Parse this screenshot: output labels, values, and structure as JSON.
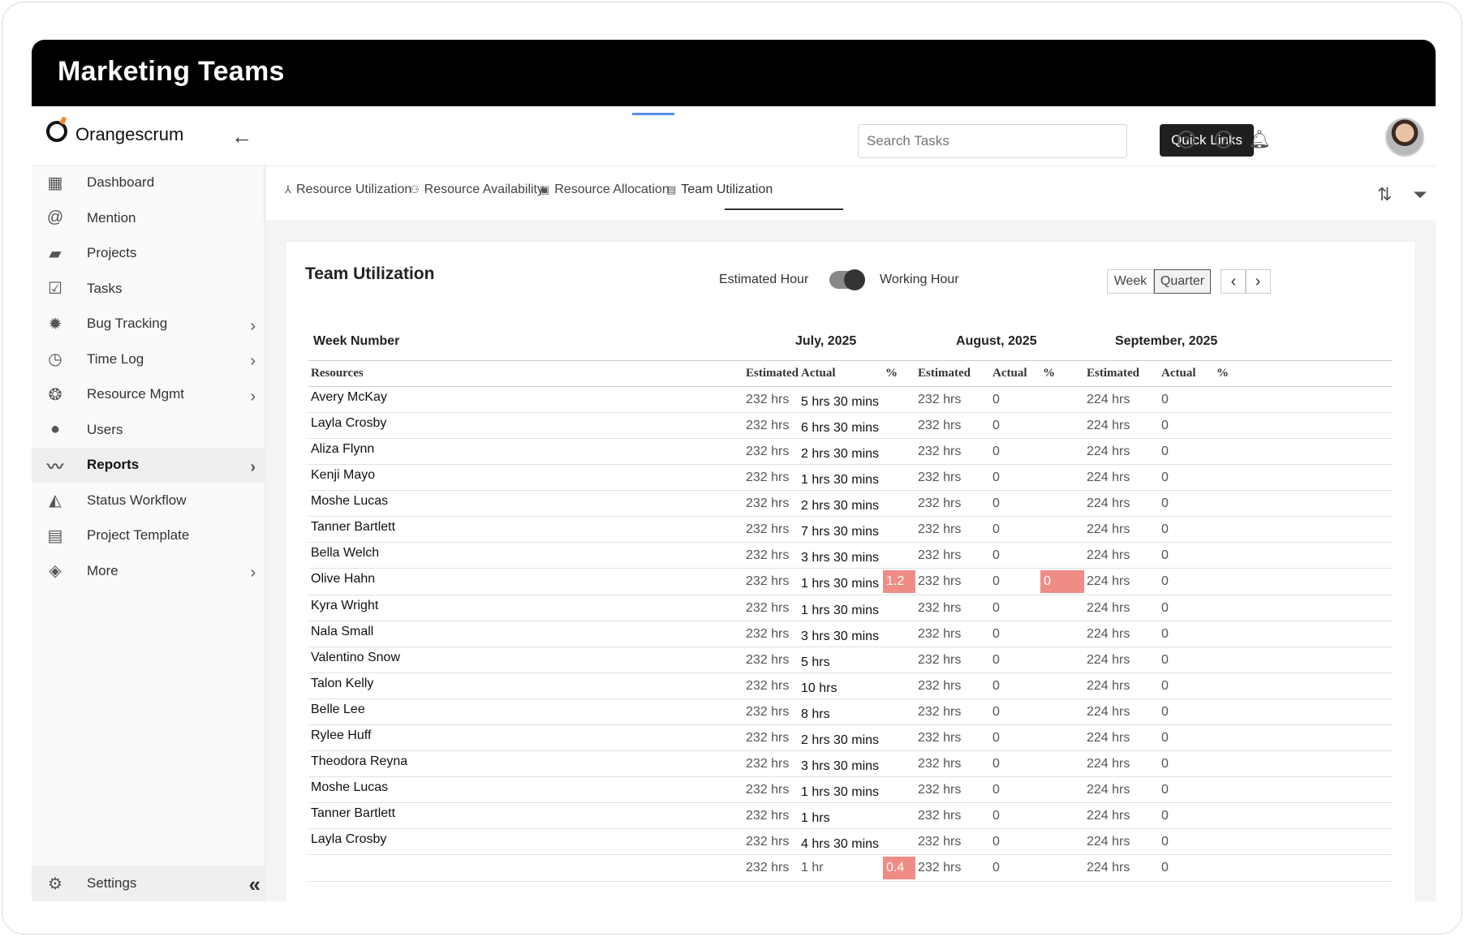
{
  "banner": {
    "title": "Marketing Teams"
  },
  "brand": {
    "name": "Orangescrum",
    "accent": "#f7852a"
  },
  "sidebar": {
    "items": [
      {
        "label": "Dashboard",
        "icon": "dashboard-icon",
        "glyph": "▦",
        "expandable": false,
        "active": false
      },
      {
        "label": "Mention",
        "icon": "at-sign-icon",
        "glyph": "@",
        "expandable": false,
        "active": false
      },
      {
        "label": "Projects",
        "icon": "briefcase-icon",
        "glyph": "▰",
        "expandable": false,
        "active": false
      },
      {
        "label": "Tasks",
        "icon": "task-check-icon",
        "glyph": "☑",
        "expandable": false,
        "active": false
      },
      {
        "label": "Bug Tracking",
        "icon": "bug-icon",
        "glyph": "✹",
        "expandable": true,
        "active": false
      },
      {
        "label": "Time Log",
        "icon": "clock-icon",
        "glyph": "◷",
        "expandable": true,
        "active": false
      },
      {
        "label": "Resource Mgmt",
        "icon": "resource-icon",
        "glyph": "❂",
        "expandable": true,
        "active": false
      },
      {
        "label": "Users",
        "icon": "user-icon",
        "glyph": "●",
        "expandable": false,
        "active": false
      },
      {
        "label": "Reports",
        "icon": "trend-line-icon",
        "glyph": "〰",
        "expandable": true,
        "active": true
      },
      {
        "label": "Status Workflow",
        "icon": "workflow-icon",
        "glyph": "◭",
        "expandable": false,
        "active": false
      },
      {
        "label": "Project Template",
        "icon": "template-icon",
        "glyph": "▤",
        "expandable": false,
        "active": false
      },
      {
        "label": "More",
        "icon": "layers-icon",
        "glyph": "◈",
        "expandable": true,
        "active": false
      }
    ],
    "settings_label": "Settings"
  },
  "header": {
    "search_placeholder": "Search Tasks",
    "quick_links_label": "Quick Links"
  },
  "tabs": [
    {
      "label": "Resource Utilization",
      "icon": "hierarchy-icon",
      "glyph": "⅄"
    },
    {
      "label": "Resource Availability",
      "icon": "users-icon",
      "glyph": "⚇"
    },
    {
      "label": "Resource Allocation",
      "icon": "allocation-icon",
      "glyph": "▣"
    },
    {
      "label": "Team Utilization",
      "icon": "document-icon",
      "glyph": "▤"
    }
  ],
  "card": {
    "title": "Team Utilization",
    "toggle_left": "Estimated Hour",
    "toggle_right": "Working Hour",
    "toggle_on": true,
    "period_week": "Week",
    "period_quarter": "Quarter",
    "selected_period": "Quarter"
  },
  "table": {
    "week_number_label": "Week Number",
    "months": [
      "July, 2025",
      "August, 2025",
      "September, 2025"
    ],
    "columns": [
      "Resources",
      "Estimated",
      "Actual",
      "%",
      "Estimated",
      "Actual",
      "%",
      "Estimated",
      "Actual",
      "%"
    ],
    "highlight_color": "#f08c86",
    "rows": [
      {
        "name": "Avery McKay",
        "cells": [
          "232 hrs",
          "5 hrs 30 mins",
          "",
          "232 hrs",
          "0",
          "",
          "224 hrs",
          "0",
          ""
        ]
      },
      {
        "name": "Layla Crosby",
        "cells": [
          "232 hrs",
          "6 hrs 30 mins",
          "",
          "232 hrs",
          "0",
          "",
          "224 hrs",
          "0",
          ""
        ]
      },
      {
        "name": "Aliza Flynn",
        "cells": [
          "232 hrs",
          "2 hrs 30 mins",
          "",
          "232 hrs",
          "0",
          "",
          "224 hrs",
          "0",
          ""
        ]
      },
      {
        "name": "Kenji Mayo",
        "cells": [
          "232 hrs",
          "1 hrs 30 mins",
          "",
          "232 hrs",
          "0",
          "",
          "224 hrs",
          "0",
          ""
        ]
      },
      {
        "name": "Moshe Lucas",
        "cells": [
          "232 hrs",
          "2 hrs 30 mins",
          "",
          "232 hrs",
          "0",
          "",
          "224 hrs",
          "0",
          ""
        ]
      },
      {
        "name": "Tanner Bartlett",
        "cells": [
          "232 hrs",
          "7 hrs 30 mins",
          "",
          "232 hrs",
          "0",
          "",
          "224 hrs",
          "0",
          ""
        ]
      },
      {
        "name": "Bella Welch",
        "cells": [
          "232 hrs",
          "3 hrs 30 mins",
          "",
          "232 hrs",
          "0",
          "",
          "224 hrs",
          "0",
          ""
        ]
      },
      {
        "name": "Olive Hahn",
        "cells": [
          "232 hrs",
          "1 hrs 30 mins",
          "1.2",
          "232 hrs",
          "0",
          "0",
          "224 hrs",
          "0",
          ""
        ]
      },
      {
        "name": "Kyra Wright",
        "cells": [
          "232 hrs",
          "1 hrs 30 mins",
          "",
          "232 hrs",
          "0",
          "",
          "224 hrs",
          "0",
          ""
        ]
      },
      {
        "name": "Nala Small",
        "cells": [
          "232 hrs",
          "3 hrs 30 mins",
          "",
          "232 hrs",
          "0",
          "",
          "224 hrs",
          "0",
          ""
        ]
      },
      {
        "name": "Valentino Snow",
        "cells": [
          "232 hrs",
          "5 hrs",
          "",
          "232 hrs",
          "0",
          "",
          "224 hrs",
          "0",
          ""
        ]
      },
      {
        "name": "Talon Kelly",
        "cells": [
          "232 hrs",
          "10 hrs",
          "",
          "232 hrs",
          "0",
          "",
          "224 hrs",
          "0",
          ""
        ]
      },
      {
        "name": "Belle Lee",
        "cells": [
          "232 hrs",
          "8 hrs",
          "",
          "232 hrs",
          "0",
          "",
          "224 hrs",
          "0",
          ""
        ]
      },
      {
        "name": "Rylee Huff",
        "cells": [
          "232 hrs",
          "2 hrs 30 mins",
          "",
          "232 hrs",
          "0",
          "",
          "224 hrs",
          "0",
          ""
        ]
      },
      {
        "name": "Theodora Reyna",
        "cells": [
          "232 hrs",
          "3 hrs 30 mins",
          "",
          "232 hrs",
          "0",
          "",
          "224 hrs",
          "0",
          ""
        ]
      },
      {
        "name": "Moshe Lucas",
        "cells": [
          "232 hrs",
          "1 hrs 30 mins",
          "",
          "232 hrs",
          "0",
          "",
          "224 hrs",
          "0",
          ""
        ]
      },
      {
        "name": "Tanner Bartlett",
        "cells": [
          "232 hrs",
          "1 hrs",
          "",
          "232 hrs",
          "0",
          "",
          "224 hrs",
          "0",
          ""
        ]
      },
      {
        "name": "Layla Crosby",
        "cells": [
          "232 hrs",
          "4 hrs 30 mins",
          "",
          "232 hrs",
          "0",
          "",
          "224 hrs",
          "0",
          ""
        ]
      },
      {
        "name": "",
        "cells": [
          "232 hrs",
          "1 hr",
          "0.4",
          "232 hrs",
          "0",
          "",
          "224 hrs",
          "0",
          ""
        ]
      }
    ]
  }
}
